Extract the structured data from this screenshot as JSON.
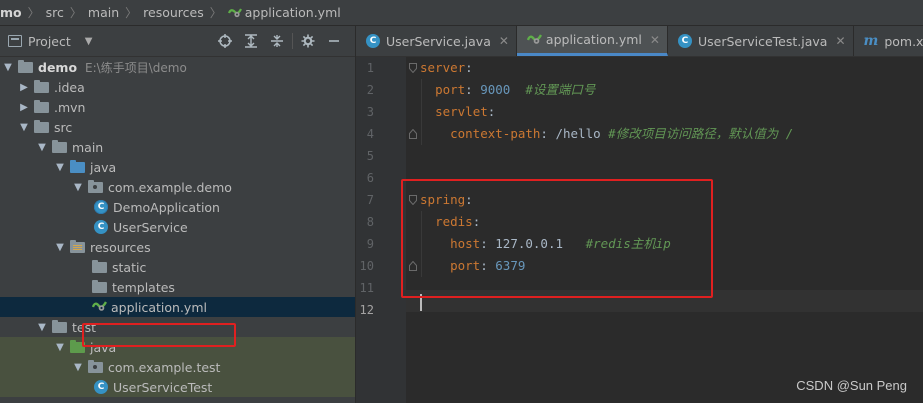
{
  "breadcrumb": {
    "items": [
      "mo",
      "src",
      "main",
      "resources",
      "application.yml"
    ]
  },
  "project_panel": {
    "title": "Project",
    "tree": [
      {
        "label": "demo",
        "path": "E:\\练手项目\\demo"
      },
      {
        "label": ".idea"
      },
      {
        "label": ".mvn"
      },
      {
        "label": "src"
      },
      {
        "label": "main"
      },
      {
        "label": "java"
      },
      {
        "label": "com.example.demo"
      },
      {
        "label": "DemoApplication"
      },
      {
        "label": "UserService"
      },
      {
        "label": "resources"
      },
      {
        "label": "static"
      },
      {
        "label": "templates"
      },
      {
        "label": "application.yml"
      },
      {
        "label": "test"
      },
      {
        "label": "java"
      },
      {
        "label": "com.example.test"
      },
      {
        "label": "UserServiceTest"
      }
    ]
  },
  "editor": {
    "tabs": [
      {
        "label": "UserService.java",
        "icon": "class-icon"
      },
      {
        "label": "application.yml",
        "icon": "yaml-icon",
        "active": true
      },
      {
        "label": "UserServiceTest.java",
        "icon": "class-icon"
      },
      {
        "label": "pom.xml (demo"
      }
    ],
    "line_numbers": [
      "1",
      "2",
      "3",
      "4",
      "5",
      "6",
      "7",
      "8",
      "9",
      "10",
      "11",
      "12"
    ],
    "current_line": "12",
    "code": {
      "l1_key": "server",
      "l2_key": "port",
      "l2_val": "9000",
      "l2_comment": "#设置端口号",
      "l3_key": "servlet",
      "l4_key": "context-path",
      "l4_val": "/hello",
      "l4_comment": "#修改项目访问路径，默认值为 /",
      "l7_key": "spring",
      "l8_key": "redis",
      "l9_key": "host",
      "l9_val": "127.0.0.1",
      "l9_comment": "#redis主机ip",
      "l10_key": "port",
      "l10_val": "6379"
    }
  },
  "watermark": "CSDN @Sun   Peng",
  "colors": {
    "keyword": "#cc7832",
    "number": "#6897bb",
    "comment": "#629755",
    "highlight_box": "#e02020",
    "selection": "#0d293e"
  }
}
